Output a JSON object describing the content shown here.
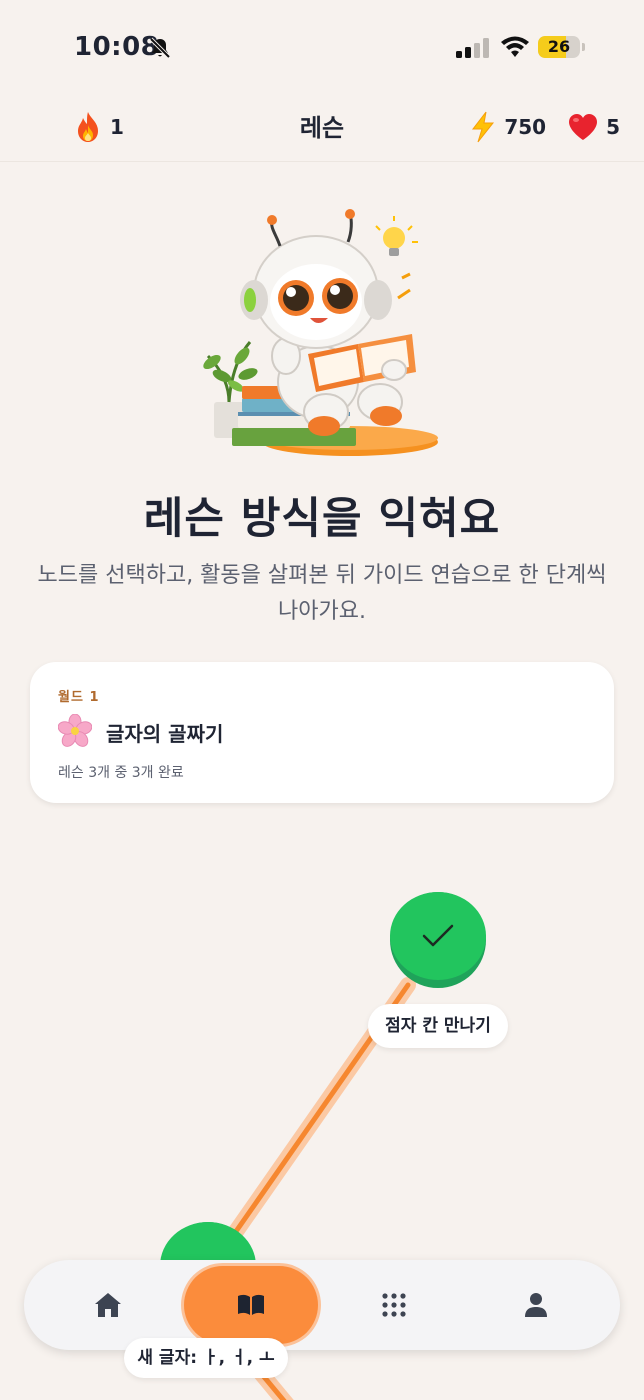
{
  "status_bar": {
    "time": "10:08",
    "battery_percent": "26",
    "battery_level": 0.26,
    "icons": [
      "bell-off-icon",
      "cellular-signal-icon",
      "wifi-icon",
      "battery-icon"
    ]
  },
  "header": {
    "title": "레슨",
    "streak": "1",
    "energy": "750",
    "hearts": "5",
    "icons": [
      "flame-icon",
      "lightning-icon",
      "heart-icon"
    ]
  },
  "hero": {
    "title": "레슨 방식을 익혀요",
    "subtitle": "노드를 선택하고, 활동을 살펴본 뒤 가이드 연습으로 한 단계씩 나아가요."
  },
  "world_card": {
    "label": "월드  1",
    "name": "글자의 골짜기",
    "progress": "레슨 3개 중 3개 완료",
    "icon": "cherry-blossom-icon"
  },
  "path": {
    "nodes": [
      {
        "label": "점자 칸 만나기",
        "status": "completed",
        "icon": "checkmark-icon"
      },
      {
        "label": "새 글자: ㅏ, ㅓ, ㅗ",
        "status": "completed",
        "icon": "checkmark-icon"
      }
    ]
  },
  "tab_bar": {
    "tabs": [
      {
        "name": "home",
        "icon": "home-icon",
        "active": false
      },
      {
        "name": "lessons",
        "icon": "book-icon",
        "active": true
      },
      {
        "name": "grid",
        "icon": "grid-icon",
        "active": false
      },
      {
        "name": "profile",
        "icon": "person-icon",
        "active": false
      }
    ]
  },
  "colors": {
    "background": "#f7f2ee",
    "accent": "#fb8c3c",
    "success": "#22c55e",
    "world_label": "#b06a2e"
  }
}
